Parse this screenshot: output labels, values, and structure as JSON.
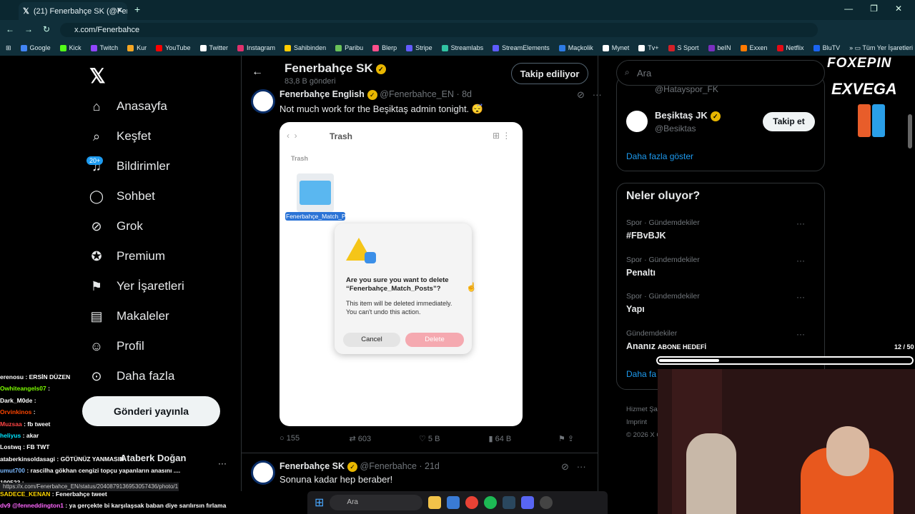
{
  "browser": {
    "tab_title": "(21) Fenerbahçe SK (@Fenerbal",
    "url": "x.com/Fenerbahce",
    "bookmarks": [
      "Google",
      "Kick",
      "Twitch",
      "Kur",
      "YouTube",
      "Twitter",
      "Instagram",
      "Sahibinden",
      "Paribu",
      "Blerp",
      "Stripe",
      "Streamlabs",
      "StreamElements",
      "Maçkolik",
      "Mynet",
      "Tv+",
      "S Sport",
      "beIN",
      "Exxen",
      "Netflix",
      "BluTV"
    ],
    "all_bookmarks": "Tüm Yer İşaretleri"
  },
  "nav": {
    "items": [
      "Anasayfa",
      "Keşfet",
      "Bildirimler",
      "Sohbet",
      "Grok",
      "Premium",
      "Yer İşaretleri",
      "Makaleler",
      "Profil",
      "Daha fazla"
    ],
    "notif_badge": "20+",
    "post_button": "Gönderi yayınla",
    "account_name": "Ataberk Doğan"
  },
  "profile": {
    "name": "Fenerbahçe SK",
    "posts": "83,8 B gönderi",
    "follow_button": "Takip ediliyor"
  },
  "tweet1": {
    "name": "Fenerbahçe English",
    "handle": "@Fenerbahce_EN · 8d",
    "text": "Not much work for the Beşiktaş admin tonight. 😴",
    "replies": "155",
    "retweets": "603",
    "likes": "5 B",
    "views": "64 B"
  },
  "media": {
    "window_title": "Trash",
    "section": "Trash",
    "folder_name": "Fenerbahçe_Match_Posts",
    "dialog_title": "Are you sure you want to delete “Fenerbahçe_Match_Posts”?",
    "dialog_body": "This item will be deleted immediately. You can't undo this action.",
    "cancel": "Cancel",
    "delete": "Delete"
  },
  "tweet2": {
    "name": "Fenerbahçe SK",
    "handle": "@Fenerbahce · 21d",
    "text": "Sonuna kadar hep beraber!"
  },
  "right": {
    "search_placeholder": "Ara",
    "partial_handle": "@Hatayspor_FK",
    "suggest_name": "Beşiktaş JK",
    "suggest_handle": "@Besiktas",
    "suggest_button": "Takip et",
    "show_more": "Daha fazla göster",
    "trends_title": "Neler oluyor?",
    "trends": [
      {
        "meta": "Spor · Gündemdekiler",
        "name": "#FBvBJK"
      },
      {
        "meta": "Spor · Gündemdekiler",
        "name": "Penaltı"
      },
      {
        "meta": "Spor · Gündemdekiler",
        "name": "Yapı"
      },
      {
        "meta": "Gündemdekiler",
        "name": "Ananız"
      }
    ],
    "show_more_2": "Daha fa",
    "footer_1": "Hizmet Şar",
    "footer_2": "Imprint",
    "footer_3": "© 2026 X C"
  },
  "stream": {
    "sponsor1": "FOXEPIN",
    "sponsor2": "EXVEGA",
    "sub_goal_label": "ABONE HEDEFİ",
    "sub_goal_count": "12 / 50",
    "sub_goal_progress": 0.24,
    "chat": [
      {
        "user": "erenosu",
        "msg": "ERSİN DÜZEN",
        "color": "#ffffff"
      },
      {
        "user": "Owhiteangels07",
        "msg": "",
        "color": "#7cfc00"
      },
      {
        "user": "Dark_M0de",
        "msg": "",
        "color": "#ffffff"
      },
      {
        "user": "Orvinkinos",
        "msg": "",
        "color": "#ff4500"
      },
      {
        "user": "Muzsaa",
        "msg": "fb tweet",
        "color": "#ff4444"
      },
      {
        "user": "heliyus",
        "msg": "akar",
        "color": "#00e5ff"
      },
      {
        "user": "Lostwq",
        "msg": "FB TWT",
        "color": "#ffffff"
      },
      {
        "user": "ataberkinsoldasagi",
        "msg": "GÖTÜNÜZ YANMASIN",
        "color": "#ffffff"
      },
      {
        "user": "umut700",
        "msg": "rascilha gökhan cengizi topçu yapanların anasını ....",
        "color": "#7ab8ff"
      },
      {
        "user": "190523",
        "msg": "",
        "color": "#ffffff"
      },
      {
        "user": "SADECE_KENAN",
        "msg": "Fenerbahçe tweet",
        "color": "#ffd700"
      },
      {
        "user": "dv9 @fenneddington1",
        "msg": "ya gerçekte bi karşılaşsak baban diye sarılırsın fırlama",
        "color": "#ff66ff"
      }
    ],
    "status_url": "https://x.com/Fenerbahce_EN/status/2040879136953057436/photo/1"
  },
  "taskbar": {
    "search": "Ara"
  }
}
